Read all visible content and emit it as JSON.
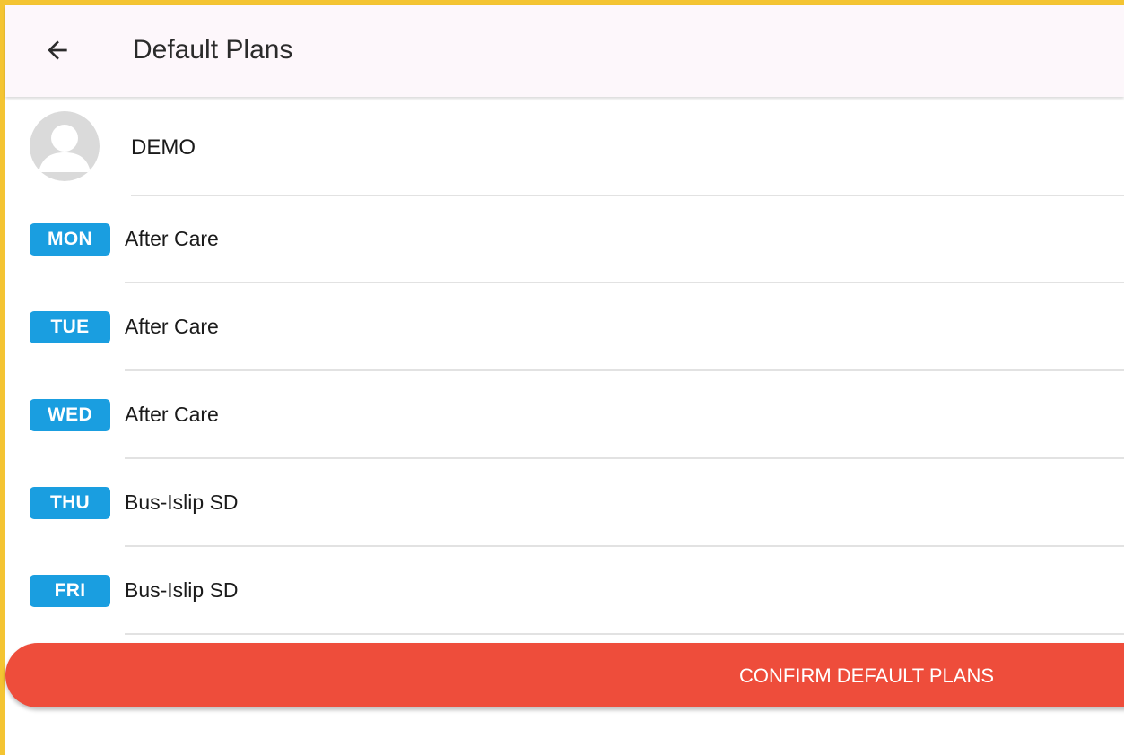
{
  "appbar": {
    "title": "Default Plans",
    "back_icon": "arrow-left-icon"
  },
  "profile": {
    "name": "DEMO",
    "avatar_icon": "default-person-avatar-icon"
  },
  "days": [
    {
      "day": "MON",
      "plan": "After Care"
    },
    {
      "day": "TUE",
      "plan": "After Care"
    },
    {
      "day": "WED",
      "plan": "After Care"
    },
    {
      "day": "THU",
      "plan": "Bus-Islip SD"
    },
    {
      "day": "FRI",
      "plan": "Bus-Islip SD"
    }
  ],
  "confirm": {
    "label": "CONFIRM DEFAULT PLANS"
  },
  "colors": {
    "frame": "#f4c432",
    "appbar_bg": "#fdf7fb",
    "badge": "#1a9ee0",
    "confirm": "#ee4d3b"
  }
}
